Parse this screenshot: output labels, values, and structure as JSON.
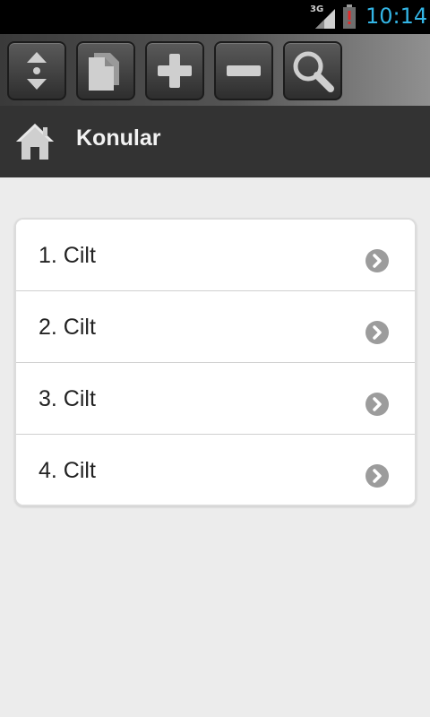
{
  "status_bar": {
    "network_type": "3G",
    "time": "10:14",
    "signal_icon": "signal-bars-icon",
    "battery_icon": "battery-alert-icon",
    "clock_color": "#33b5e5"
  },
  "toolbar": {
    "buttons": [
      {
        "name": "expand-collapse-button",
        "icon": "up-down-arrows-icon"
      },
      {
        "name": "copy-button",
        "icon": "documents-icon"
      },
      {
        "name": "zoom-in-button",
        "icon": "plus-icon"
      },
      {
        "name": "zoom-out-button",
        "icon": "minus-icon"
      },
      {
        "name": "search-button",
        "icon": "search-icon"
      }
    ]
  },
  "header": {
    "title": "Konular",
    "home_icon": "home-icon"
  },
  "list": {
    "items": [
      {
        "label": "1. Cilt"
      },
      {
        "label": "2. Cilt"
      },
      {
        "label": "3. Cilt"
      },
      {
        "label": "4. Cilt"
      }
    ]
  }
}
